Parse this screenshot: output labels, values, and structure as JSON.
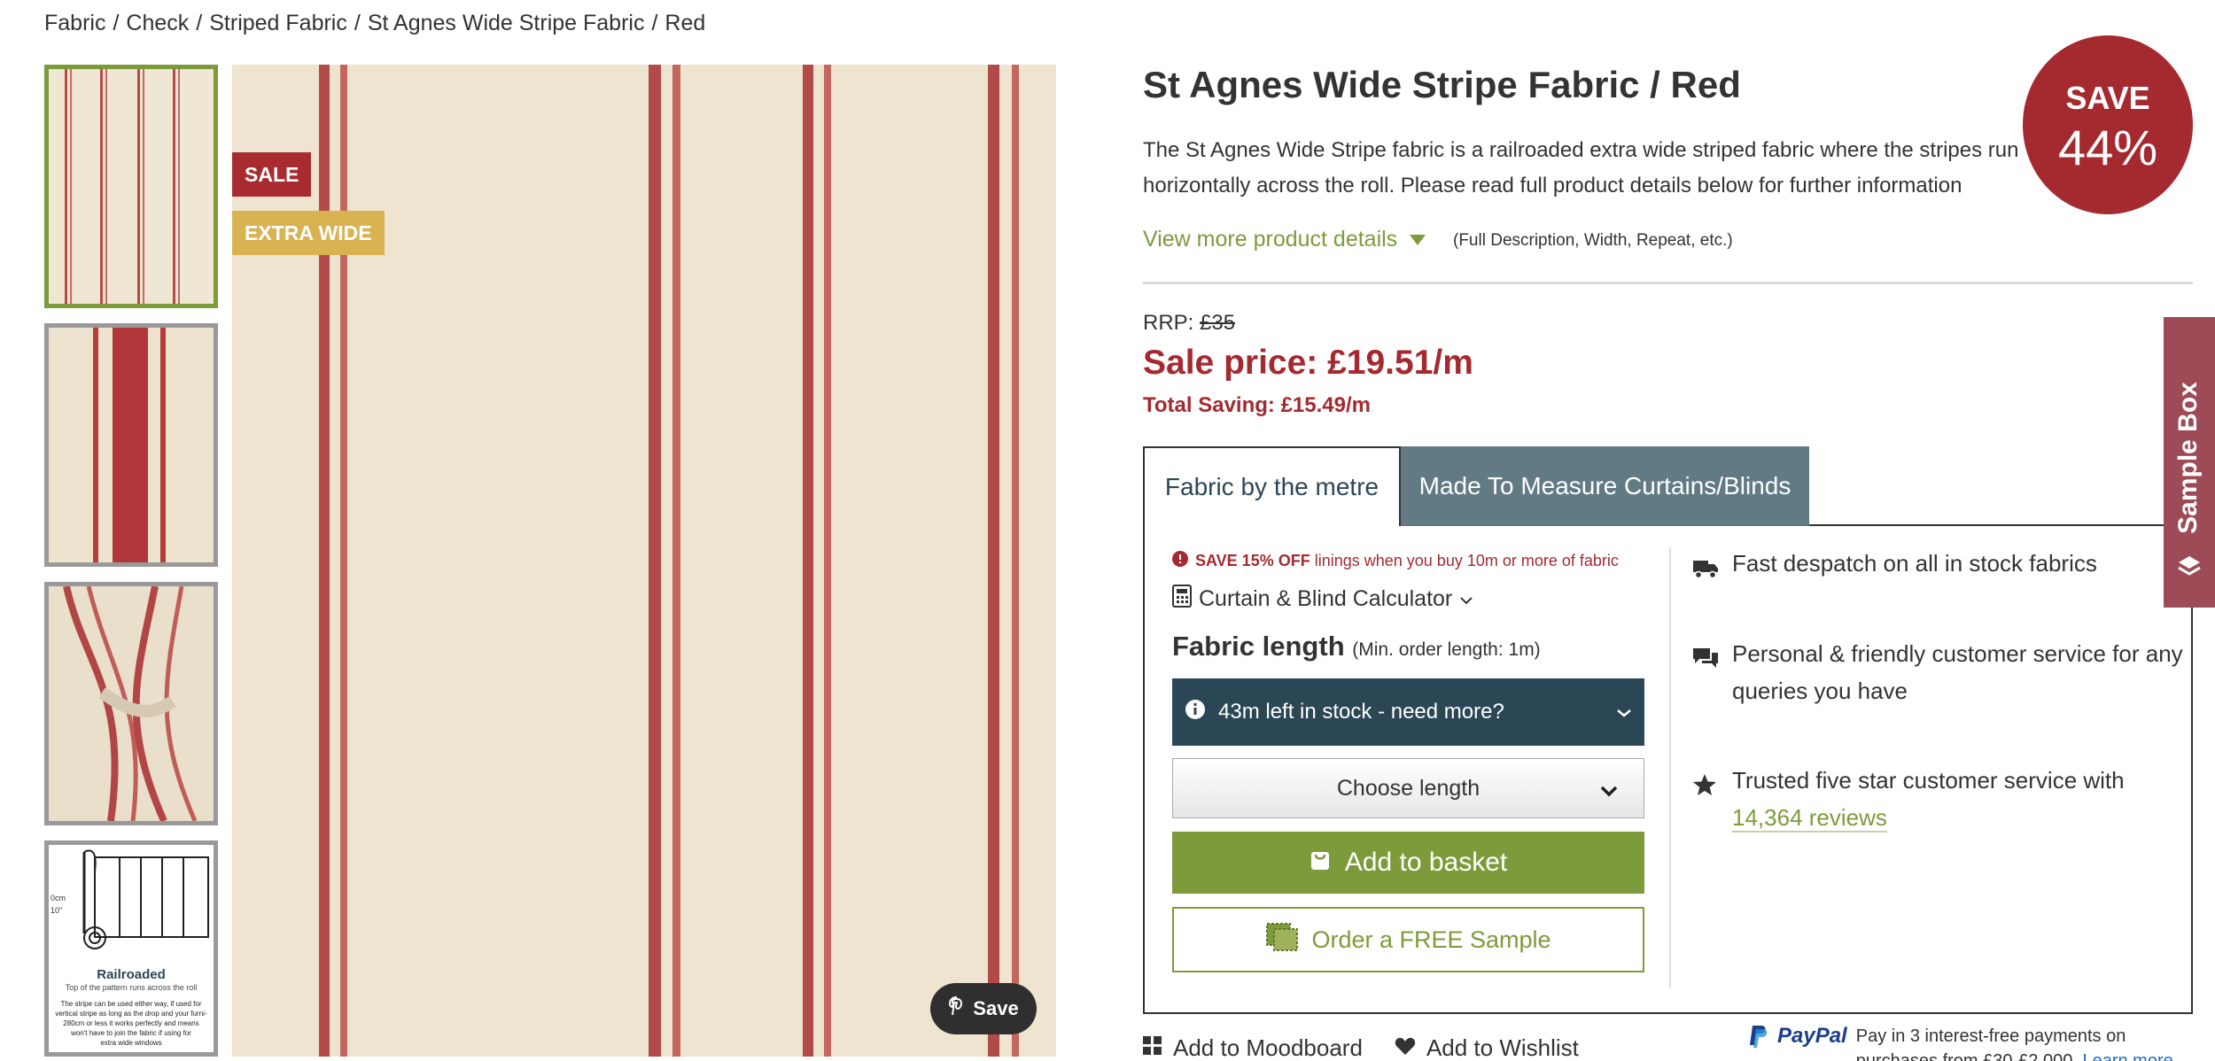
{
  "breadcrumb": [
    "Fabric",
    "Check",
    "Striped Fabric",
    "St Agnes Wide Stripe Fabric",
    "Red"
  ],
  "gallery": {
    "badges": {
      "sale": "SALE",
      "extra_wide": "EXTRA WIDE"
    },
    "pin_save_label": "Save",
    "railroaded_title": "Railroaded",
    "railroaded_caption": "Top of the pattern runs across the roll",
    "railroaded_note_lines": [
      "The stripe can be used either way, if used for",
      "vertical stripe as long as the drop and your furni-",
      "280cm or less it works perfectly and means",
      "won't have to join the fabric if using for",
      "extra wide windows"
    ],
    "railroaded_dims": [
      "0cm",
      "10\""
    ]
  },
  "product": {
    "title": "St Agnes Wide Stripe Fabric / Red",
    "description": "The St Agnes Wide Stripe fabric is a railroaded extra wide striped fabric where the stripes run horizontally across the roll. Please read full product details below for further information",
    "save_badge": {
      "line1": "SAVE",
      "line2": "44%"
    },
    "more_details_link": "View more product details",
    "more_details_note": "(Full Description, Width, Repeat, etc.)",
    "rrp_label": "RRP:",
    "rrp_value": "£35",
    "sale_price": "Sale price: £19.51/m",
    "total_saving": "Total Saving: £15.49/m"
  },
  "tabs": {
    "fabric": "Fabric by the metre",
    "made_to_measure": "Made To Measure Curtains/Blinds"
  },
  "purchase": {
    "promo_bold": "SAVE 15% OFF",
    "promo_text": "linings when you buy 10m or more of fabric",
    "calculator_label": "Curtain & Blind Calculator",
    "length_label": "Fabric length",
    "min_order": "(Min. order length: 1m)",
    "stock_text": "43m left in stock - need more?",
    "choose_length": "Choose length",
    "add_to_basket": "Add to basket",
    "order_sample": "Order a FREE Sample"
  },
  "features": [
    {
      "icon": "truck-icon",
      "text": "Fast despatch on all in stock fabrics"
    },
    {
      "icon": "chat-icon",
      "text": "Personal & friendly customer service for any queries you have"
    },
    {
      "icon": "star-icon",
      "text": "Trusted five star customer service with",
      "link": "14,364 reviews"
    }
  ],
  "sample_box_label": "Sample Box",
  "bottom": {
    "moodboard": "Add to Moodboard",
    "wishlist": "Add to Wishlist",
    "paypal_brand": "PayPal",
    "paypal_text": "Pay in 3 interest-free payments on",
    "paypal_text2": "purchases from £30-£2,000.",
    "paypal_link": "Learn more"
  },
  "colors": {
    "accent_green": "#7d9b3a",
    "sale_red": "#a42a30",
    "stock_navy": "#2b4756",
    "tab_grey": "#627a83",
    "sample_box": "#9c4b57"
  }
}
